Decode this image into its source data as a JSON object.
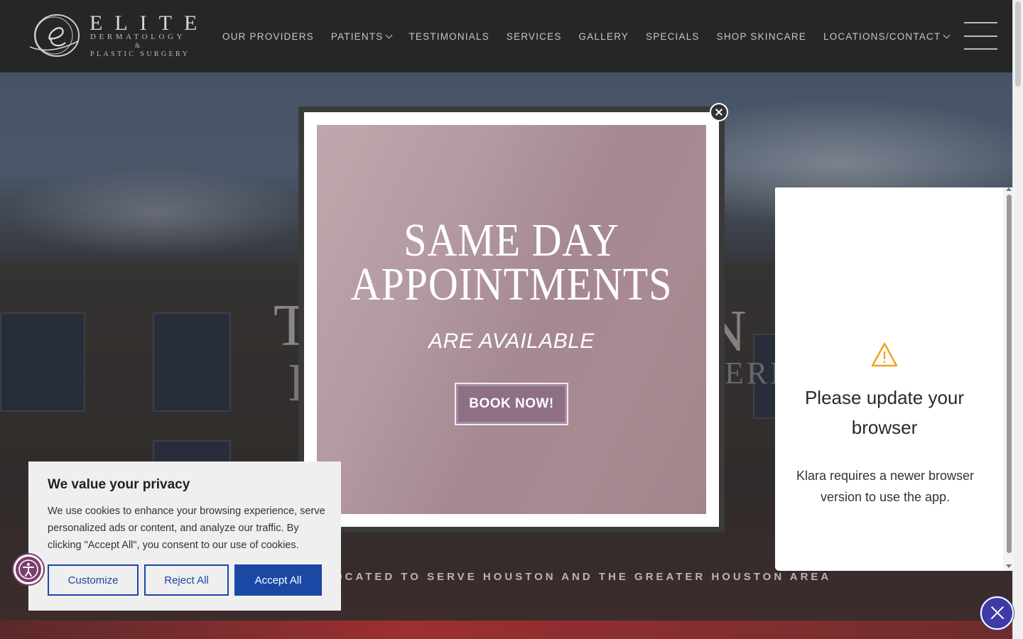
{
  "header": {
    "logo": {
      "name": "ELITE",
      "line2": "DERMATOLOGY",
      "line3": "&",
      "line4": "PLASTIC SURGERY"
    },
    "nav": [
      {
        "label": "OUR PROVIDERS",
        "dropdown": false
      },
      {
        "label": "PATIENTS",
        "dropdown": true
      },
      {
        "label": "TESTIMONIALS",
        "dropdown": false
      },
      {
        "label": "SERVICES",
        "dropdown": false
      },
      {
        "label": "GALLERY",
        "dropdown": false
      },
      {
        "label": "SPECIALS",
        "dropdown": false
      },
      {
        "label": "SHOP SKINCARE",
        "dropdown": false
      },
      {
        "label": "LOCATIONS/CONTACT",
        "dropdown": true
      }
    ],
    "menu_icon": "hamburger-icon"
  },
  "hero": {
    "title_fragment_left": "T",
    "title_fragment_left2": "I",
    "title_fragment_right": "N",
    "title_fragment_right2": "ERM",
    "tagline": "OCATED TO SERVE HOUSTON AND THE GREATER HOUSTON AREA"
  },
  "popup": {
    "heading": "SAME DAY APPOINTMENTS",
    "subheading": "ARE AVAILABLE",
    "cta": "BOOK NOW!",
    "close_icon": "close-icon"
  },
  "cookie": {
    "title": "We value your privacy",
    "text": "We use cookies to enhance your browsing experience, serve personalized ads or content, and analyze our traffic. By clicking \"Accept All\", you consent to our use of cookies.",
    "buttons": {
      "customize": "Customize",
      "reject": "Reject All",
      "accept": "Accept All"
    },
    "accent_color": "#1b47a5"
  },
  "accessibility": {
    "icon": "accessibility-icon"
  },
  "klara": {
    "icon": "warning-icon",
    "heading": "Please update your browser",
    "message": "Klara requires a newer browser version to use the app.",
    "close_icon": "close-icon",
    "accent_color": "#3f3aa6"
  }
}
